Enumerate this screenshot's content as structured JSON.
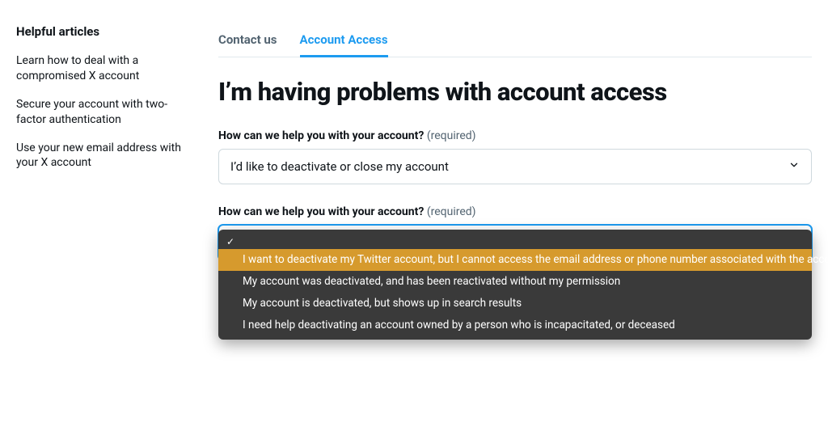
{
  "sidebar": {
    "heading": "Helpful articles",
    "items": [
      "Learn how to deal with a compromised X account",
      "Secure your account with two-factor authentication",
      "Use your new email address with your X account"
    ]
  },
  "tabs": {
    "contact": "Contact us",
    "access": "Account Access"
  },
  "page_title": "I’m having problems with account access",
  "field1": {
    "label": "How can we help you with your account?",
    "required": "(required)",
    "value": "I’d like to deactivate or close my account"
  },
  "field2": {
    "label": "How can we help you with your account?",
    "required": "(required)",
    "options": [
      "",
      "I want to deactivate my Twitter account, but I cannot access the email address or phone number associated with the account",
      "My account was deactivated, and has been reactivated without my permission",
      "My account is deactivated, but shows up in search results",
      "I need help deactivating an account owned by a person who is incapacitated, or deceased"
    ]
  }
}
